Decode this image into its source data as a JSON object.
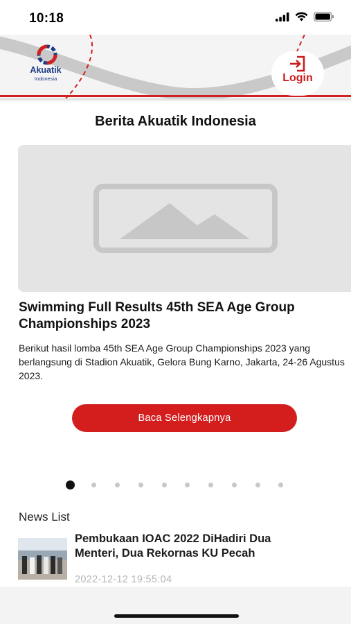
{
  "status_bar": {
    "time": "10:18"
  },
  "header": {
    "logo_name": "Akuatik",
    "logo_sub": "Indonesia",
    "login_label": "Login",
    "accent_color": "#d21f1f"
  },
  "main": {
    "section_title": "Berita Akuatik Indonesia",
    "featured": {
      "title": "Swimming Full Results 45th SEA Age Group Championships 2023",
      "description": "Berikut hasil lomba 45th SEA Age Group Championships 2023 yang berlangsung di Stadion Akuatik, Gelora Bung Karno, Jakarta, 24-26 Agustus 2023.",
      "button_label": "Baca Selengkapnya",
      "image_icon": "image-placeholder-icon"
    },
    "pager": {
      "total": 10,
      "active": 1
    }
  },
  "news_list": {
    "heading": "News List",
    "items": [
      {
        "title": "Pembukaan IOAC 2022 DiHadiri Dua Menteri, Dua Rekornas KU Pecah",
        "date": "2022-12-12 19:55:04"
      }
    ]
  }
}
